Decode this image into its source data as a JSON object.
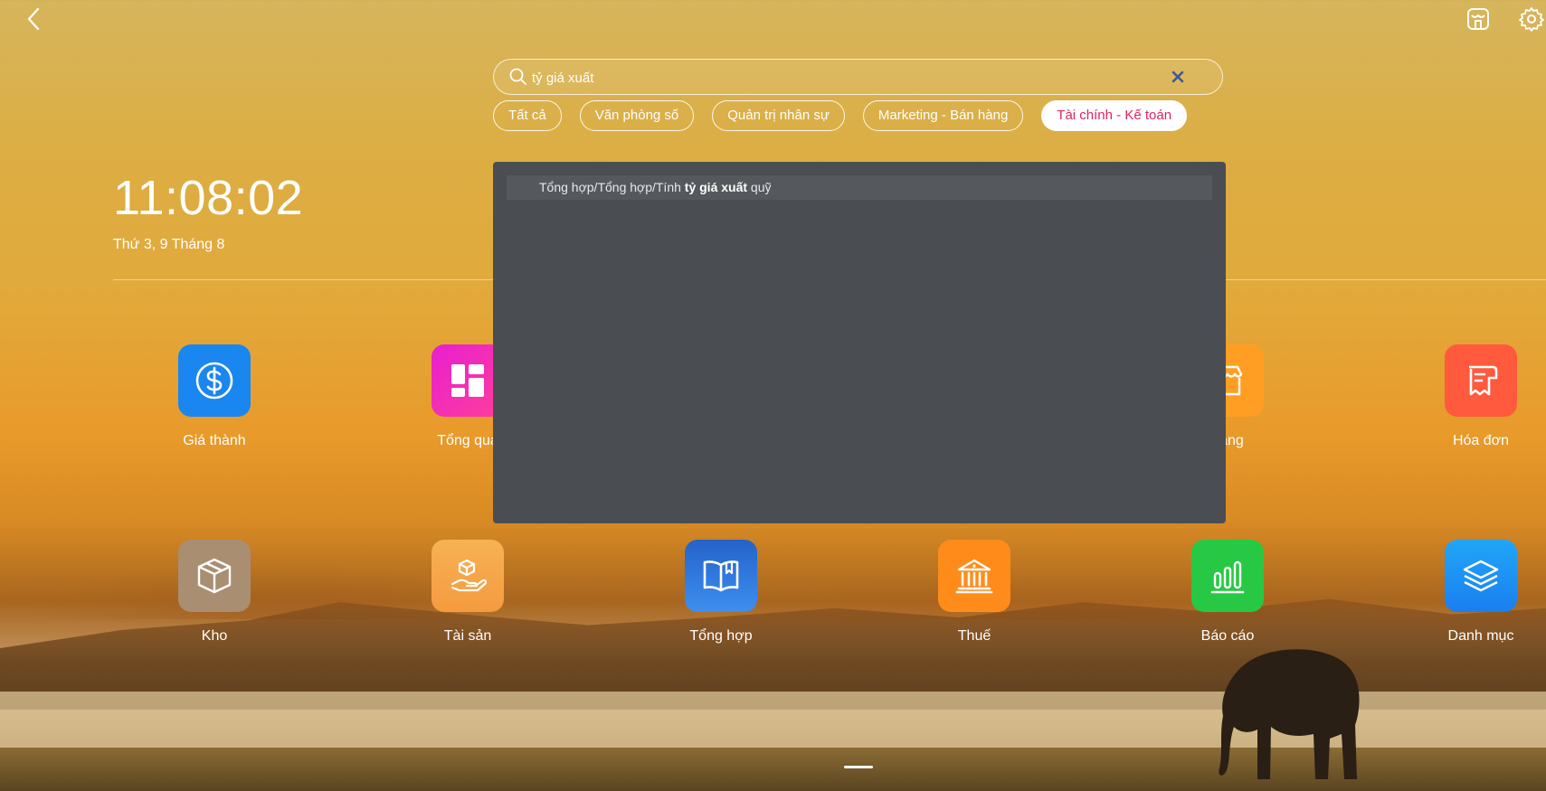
{
  "search": {
    "value": "tỷ giá xuất",
    "placeholder": ""
  },
  "categories": [
    {
      "label": "Tất cả",
      "active": false
    },
    {
      "label": "Văn phòng số",
      "active": false
    },
    {
      "label": "Quản trị nhân sự",
      "active": false
    },
    {
      "label": "Marketing - Bán hàng",
      "active": false
    },
    {
      "label": "Tài chính - Kế toán",
      "active": true
    }
  ],
  "clock": {
    "time": "11:08:02",
    "date": "Thứ 3, 9 Tháng 8"
  },
  "results": [
    {
      "prefix": "Tổng hợp/Tổng hợp/Tính ",
      "match": "tỷ giá xuất",
      "suffix": " quỹ"
    }
  ],
  "apps_row1": [
    {
      "label": "Giá thành",
      "icon": "dollar-circle-icon",
      "color": "#1a86f0"
    },
    {
      "label": "Tổng qua",
      "icon": "dashboard-icon",
      "color": "#e81fd0"
    },
    {
      "label": "hàng",
      "icon": "store-icon",
      "color": "#ff9e22"
    },
    {
      "label": "Hóa đơn",
      "icon": "receipt-icon",
      "color": "#ff5a3d"
    }
  ],
  "apps_row2": [
    {
      "label": "Kho",
      "icon": "box-icon",
      "color": "#a98e72"
    },
    {
      "label": "Tài sản",
      "icon": "asset-hand-icon",
      "color": "#f6a849"
    },
    {
      "label": "Tổng hợp",
      "icon": "book-icon",
      "color": "#2f7fe0"
    },
    {
      "label": "Thuế",
      "icon": "bank-icon",
      "color": "#ff8c1a"
    },
    {
      "label": "Báo cáo",
      "icon": "bar-chart-icon",
      "color": "#27c944"
    },
    {
      "label": "Danh mục",
      "icon": "layers-icon",
      "color": "#1a8cf5"
    }
  ]
}
